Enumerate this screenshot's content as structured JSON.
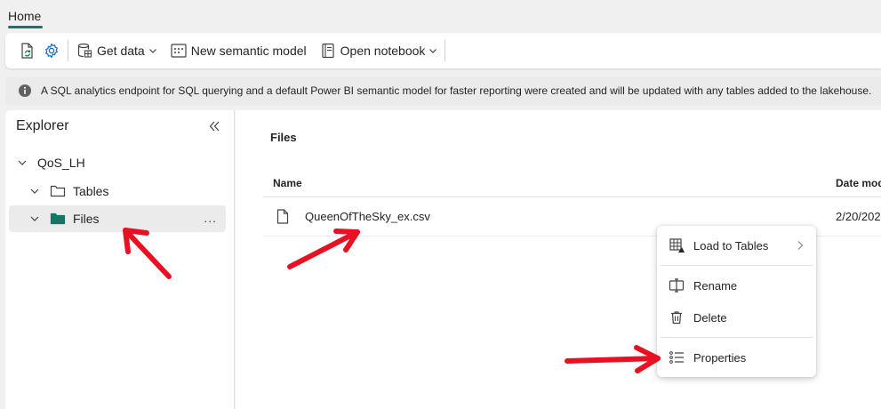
{
  "tabs": {
    "home": "Home"
  },
  "ribbon": {
    "get_data": "Get data",
    "new_semantic_model": "New semantic model",
    "open_notebook": "Open notebook"
  },
  "info": {
    "message": "A SQL analytics endpoint for SQL querying and a default Power BI semantic model for faster reporting were created and will be updated with any tables added to the lakehouse."
  },
  "explorer": {
    "title": "Explorer",
    "root": "QoS_LH",
    "items": [
      {
        "label": "Tables"
      },
      {
        "label": "Files",
        "more": "..."
      }
    ]
  },
  "main": {
    "title": "Files",
    "columns": {
      "name": "Name",
      "date": "Date mod"
    },
    "rows": [
      {
        "name": "QueenOfTheSky_ex.csv",
        "date": "2/20/202"
      }
    ]
  },
  "context_menu": {
    "items": [
      {
        "label": "Load to Tables"
      },
      {
        "label": "Rename"
      },
      {
        "label": "Delete"
      },
      {
        "label": "Properties"
      }
    ]
  },
  "colors": {
    "accent": "#117865",
    "annotation": "#e81123"
  }
}
